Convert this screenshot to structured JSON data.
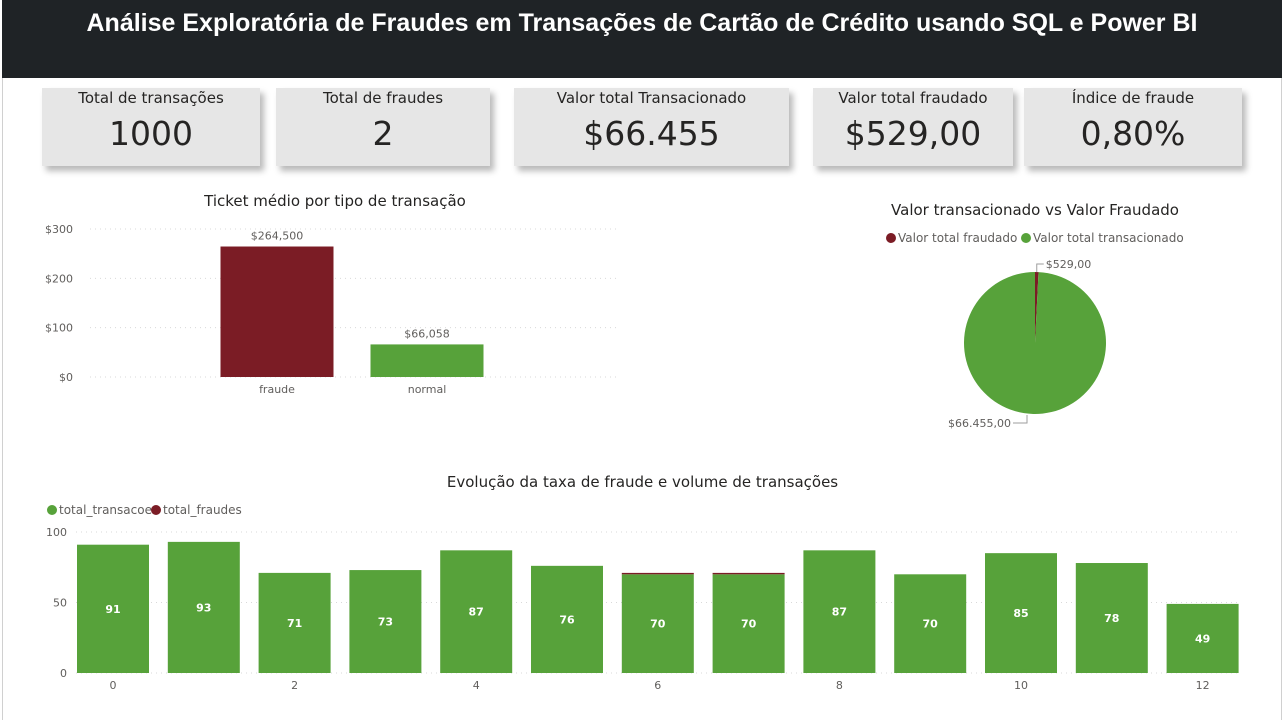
{
  "header": {
    "title": "Análise Exploratória de Fraudes em Transações de Cartão de Crédito usando SQL e Power BI"
  },
  "colors": {
    "fraud": "#7b1c25",
    "normal": "#57a23a",
    "header_bg": "#1f2326",
    "card_bg": "#e6e6e6"
  },
  "kpis": [
    {
      "label": "Total de transações",
      "value": "1000"
    },
    {
      "label": "Total de fraudes",
      "value": "2"
    },
    {
      "label": "Valor total Transacionado",
      "value": "$66.455"
    },
    {
      "label": "Valor total fraudado",
      "value": "$529,00"
    },
    {
      "label": "Índice de fraude",
      "value": "0,80%"
    }
  ],
  "chart_data": [
    {
      "type": "bar",
      "title": "Ticket médio por tipo de transação",
      "categories": [
        "fraude",
        "normal"
      ],
      "values": [
        264.5,
        66.058
      ],
      "data_labels": [
        "$264,500",
        "$66,058"
      ],
      "yticks": [
        0,
        100,
        200,
        300
      ],
      "ytick_labels": [
        "$0",
        "$100",
        "$200",
        "$300"
      ],
      "ylim": [
        0,
        300
      ],
      "grid": true
    },
    {
      "type": "pie",
      "title": "Valor transacionado vs Valor Fraudado",
      "legend": [
        "Valor total fraudado",
        "Valor total transacionado"
      ],
      "labels": [
        "Valor total fraudado",
        "Valor total transacionado"
      ],
      "values": [
        529,
        66455
      ],
      "data_labels": [
        "$529,00",
        "$66.455,00"
      ],
      "legend_position": "top"
    },
    {
      "type": "bar",
      "stacked": true,
      "title": "Evolução da taxa de fraude e volume de transações",
      "legend": [
        "total_transacoes",
        "total_fraudes"
      ],
      "legend_position": "top-left",
      "x": [
        0,
        1,
        2,
        3,
        4,
        5,
        6,
        7,
        8,
        9,
        10,
        11,
        12
      ],
      "xticks": [
        0,
        2,
        4,
        6,
        8,
        10,
        12
      ],
      "series": [
        {
          "name": "total_transacoes",
          "values": [
            91,
            93,
            71,
            73,
            87,
            76,
            70,
            70,
            87,
            70,
            85,
            78,
            49
          ]
        },
        {
          "name": "total_fraudes",
          "values": [
            0,
            0,
            0,
            0,
            0,
            0,
            1,
            1,
            0,
            0,
            0,
            0,
            0
          ]
        }
      ],
      "yticks": [
        0,
        50,
        100
      ],
      "ylim": [
        0,
        100
      ],
      "grid": true
    }
  ]
}
